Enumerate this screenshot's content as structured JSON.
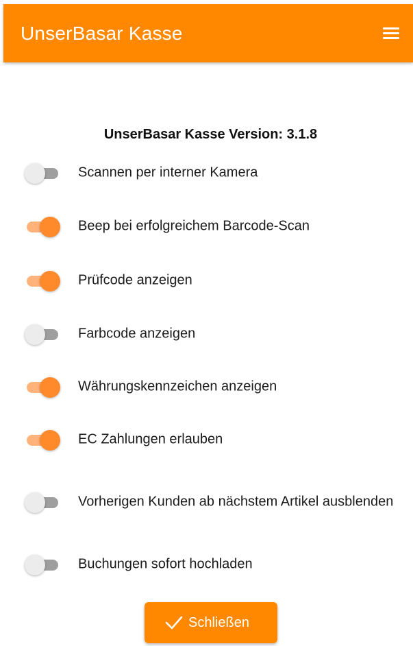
{
  "appbar": {
    "title": "UnserBasar Kasse",
    "menu_icon": "hamburger-menu-icon"
  },
  "version_text": "UnserBasar Kasse Version: 3.1.8",
  "settings": [
    {
      "label": "Scannen per interner Kamera",
      "enabled": false
    },
    {
      "label": "Beep bei erfolgreichem Barcode-Scan",
      "enabled": true
    },
    {
      "label": "Prüfcode anzeigen",
      "enabled": true
    },
    {
      "label": "Farbcode anzeigen",
      "enabled": false
    },
    {
      "label": "Währungskennzeichen anzeigen",
      "enabled": true
    },
    {
      "label": "EC Zahlungen erlauben",
      "enabled": true
    },
    {
      "label": "Vorherigen Kunden ab nächstem Artikel ausblenden",
      "enabled": false
    },
    {
      "label": "Buchungen sofort hochladen",
      "enabled": false
    }
  ],
  "close_button": {
    "label": "Schließen",
    "icon": "checkmark-icon"
  },
  "colors": {
    "accent": "#FF8800",
    "switch_on_thumb": "#FF8A2B",
    "switch_on_track": "#FFB37A",
    "switch_off_thumb": "#ECECEC",
    "switch_off_track": "#9E9E9E"
  }
}
